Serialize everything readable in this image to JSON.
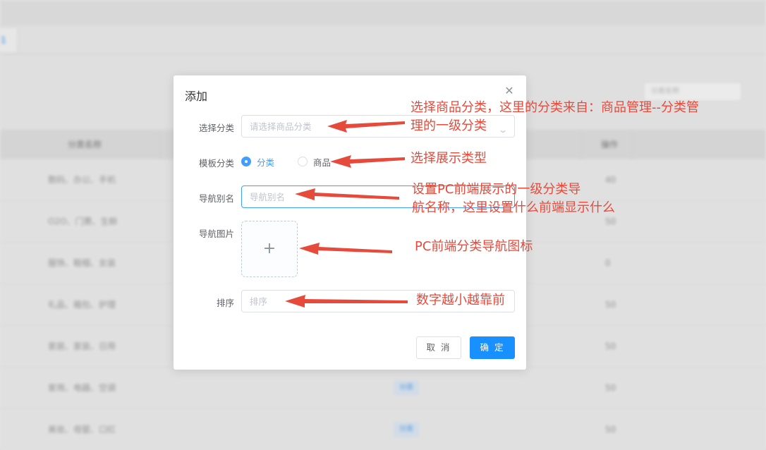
{
  "background": {
    "tab_label": "1",
    "search_placeholder": "分类名称",
    "table_headers": [
      "分类名称",
      "",
      "",
      "操作"
    ],
    "rows": [
      {
        "name": "数码、办公、手机",
        "num": "40"
      },
      {
        "name": "O2O、门票、生鲜",
        "num": "50"
      },
      {
        "name": "服饰、鞋帽、女装",
        "num": "0"
      },
      {
        "name": "礼品、箱包、护理",
        "num": "50"
      },
      {
        "name": "家居、家装、日用",
        "num": "50"
      },
      {
        "name": "家用、电器、空调",
        "num": "50",
        "tag": "分类"
      },
      {
        "name": "美妆、母婴、口红",
        "num": "50",
        "tag": "分类"
      }
    ]
  },
  "dialog": {
    "title": "添加",
    "close_icon": "close-icon",
    "fields": {
      "category_label": "选择分类",
      "category_placeholder": "请选择商品分类",
      "template_label": "模板分类",
      "template_options": [
        {
          "label": "分类",
          "selected": true
        },
        {
          "label": "商品",
          "selected": false
        }
      ],
      "alias_label": "导航别名",
      "alias_placeholder": "导航别名",
      "image_label": "导航图片",
      "upload_icon": "+",
      "sort_label": "排序",
      "sort_placeholder": "排序"
    },
    "cancel_label": "取 消",
    "ok_label": "确 定"
  },
  "annotations": {
    "note1_line1": "选择商品分类，这里的分类来自：商品管理--分类管",
    "note1_line2": "理的一级分类",
    "note2": "选择展示类型",
    "note3_line1": "设置PC前端展示的一级分类导",
    "note3_line2": "航名称，这里设置什么前端显示什么",
    "note4": "PC前端分类导航图标",
    "note5": "数字越小越靠前",
    "arrow_color": "#e64a3b"
  },
  "colors": {
    "primary": "#409eff",
    "ok_button": "#1890ff",
    "annotation": "#e64a3b"
  }
}
